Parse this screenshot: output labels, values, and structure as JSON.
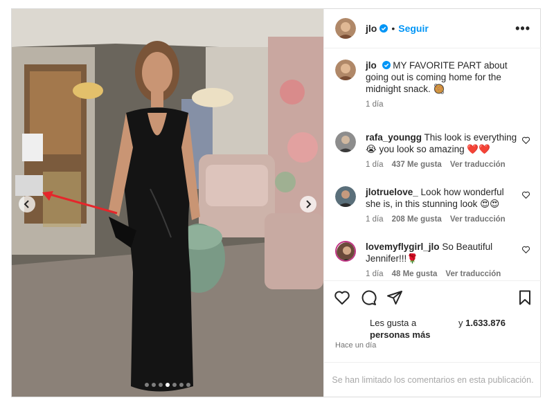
{
  "author": {
    "username": "jlo",
    "follow_label": "Seguir",
    "separator": "•"
  },
  "caption": {
    "username": "jlo",
    "text": "MY FAVORITE PART about going out is coming home for the midnight snack. 🥘",
    "time": "1 día"
  },
  "comments": [
    {
      "username": "rafa_youngg",
      "text": "This look is everything 😭 you look so amazing ❤️❤️",
      "time": "1 día",
      "likes": "437 Me gusta",
      "translate": "Ver traducción"
    },
    {
      "username": "jlotruelove_",
      "text": "Look how wonderful she is, in this stunning look 😍😍",
      "time": "1 día",
      "likes": "208 Me gusta",
      "translate": "Ver traducción"
    },
    {
      "username": "lovemyflygirl_jlo",
      "text": "So Beautiful Jennifer!!!🌹",
      "time": "1 día",
      "likes": "48 Me gusta",
      "translate": "Ver traducción"
    }
  ],
  "likes": {
    "line1": "Les gusta a",
    "line2": "personas más",
    "line3_prefix": "y",
    "count": "1.633.876"
  },
  "time_ago": "Hace un día",
  "comments_limited": "Se han limitado los comentarios en esta publicación.",
  "carousel": {
    "slides": 7,
    "active": 3
  },
  "icons": {
    "verified": "verified-badge-icon",
    "more": "more-options-icon",
    "like": "heart-icon",
    "comment": "comment-icon",
    "share": "send-icon",
    "save": "bookmark-icon",
    "prev": "chevron-left-icon",
    "next": "chevron-right-icon"
  },
  "colors": {
    "accent": "#0095f6",
    "muted": "#737373",
    "annotation_arrow": "#e5262b",
    "verified": "#0095f6"
  }
}
